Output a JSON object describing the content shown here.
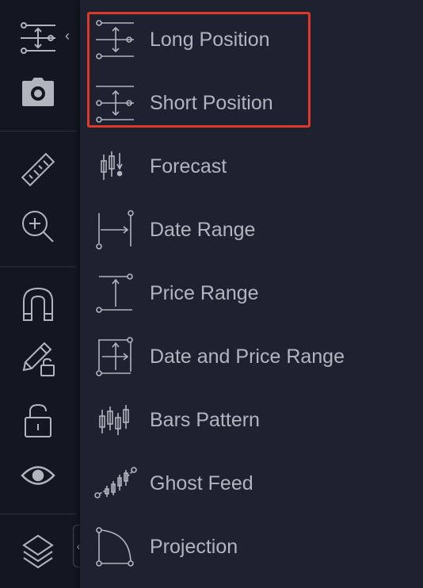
{
  "toolbar": {
    "items": [
      {
        "name": "long-short-position-tool",
        "icon": "position-icon"
      },
      {
        "name": "screenshot",
        "icon": "camera-icon"
      },
      {
        "name": "measure",
        "icon": "ruler-icon"
      },
      {
        "name": "zoom-in",
        "icon": "zoom-in-icon"
      },
      {
        "name": "magnet",
        "icon": "magnet-icon"
      },
      {
        "name": "stay-in-drawing-mode",
        "icon": "pencil-lock-icon"
      },
      {
        "name": "lock-drawings",
        "icon": "lock-open-icon"
      },
      {
        "name": "hide-drawings",
        "icon": "eye-icon"
      },
      {
        "name": "object-tree",
        "icon": "layers-icon"
      }
    ]
  },
  "menu": {
    "items": [
      {
        "label": "Long Position",
        "icon": "long-position-icon"
      },
      {
        "label": "Short Position",
        "icon": "short-position-icon"
      },
      {
        "label": "Forecast",
        "icon": "forecast-icon"
      },
      {
        "label": "Date Range",
        "icon": "date-range-icon"
      },
      {
        "label": "Price Range",
        "icon": "price-range-icon"
      },
      {
        "label": "Date and Price Range",
        "icon": "date-price-range-icon"
      },
      {
        "label": "Bars Pattern",
        "icon": "bars-pattern-icon"
      },
      {
        "label": "Ghost Feed",
        "icon": "ghost-feed-icon"
      },
      {
        "label": "Projection",
        "icon": "projection-icon"
      }
    ]
  },
  "colors": {
    "background": "#131722",
    "menu_background": "#1e2130",
    "text": "#b2b5be",
    "highlight": "#e0392b"
  }
}
